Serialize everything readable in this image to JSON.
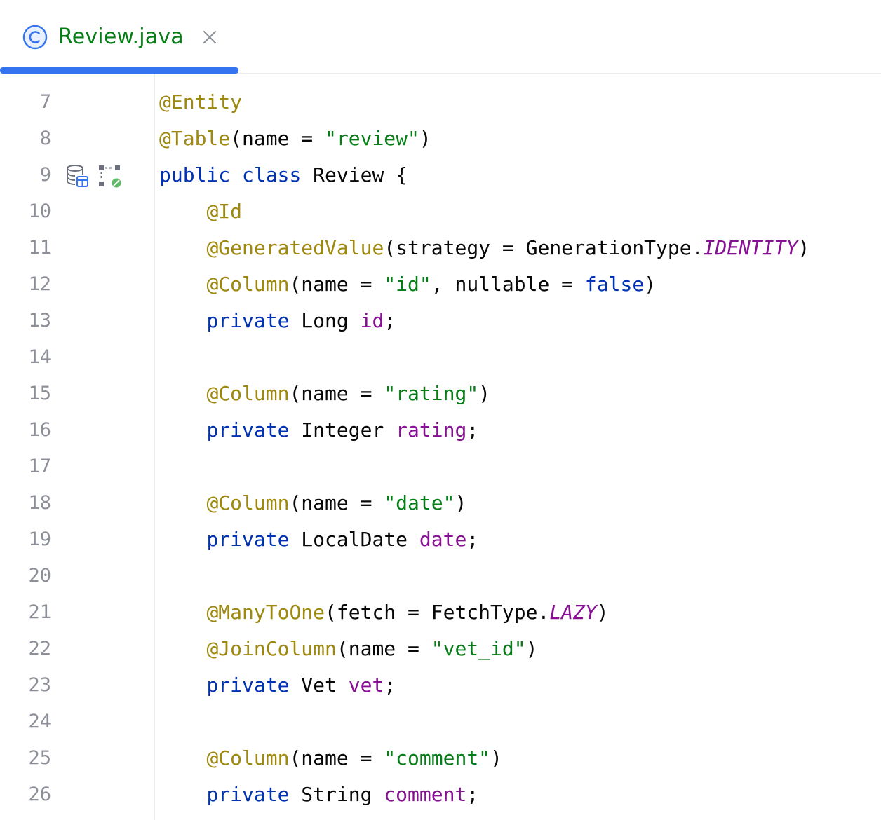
{
  "tab": {
    "title": "Review.java",
    "icon": "class-icon",
    "close_icon": "close-icon"
  },
  "editor": {
    "lines": [
      {
        "num": "7",
        "tokens": [
          [
            "ann",
            "@Entity"
          ]
        ]
      },
      {
        "num": "8",
        "tokens": [
          [
            "ann",
            "@Table"
          ],
          [
            "",
            "(name = "
          ],
          [
            "str",
            "\"review\""
          ],
          [
            "",
            ")"
          ]
        ]
      },
      {
        "num": "9",
        "tokens": [
          [
            "kw",
            "public"
          ],
          [
            "",
            " "
          ],
          [
            "kw",
            "class"
          ],
          [
            "",
            " Review {"
          ]
        ],
        "gutter_icons": [
          "database-table-icon",
          "entity-diagram-icon"
        ]
      },
      {
        "num": "10",
        "tokens": [
          [
            "",
            "    "
          ],
          [
            "ann",
            "@Id"
          ]
        ]
      },
      {
        "num": "11",
        "tokens": [
          [
            "",
            "    "
          ],
          [
            "ann",
            "@GeneratedValue"
          ],
          [
            "",
            "(strategy = GenerationType."
          ],
          [
            "ist",
            "IDENTITY"
          ],
          [
            "",
            ")"
          ]
        ]
      },
      {
        "num": "12",
        "tokens": [
          [
            "",
            "    "
          ],
          [
            "ann",
            "@Column"
          ],
          [
            "",
            "(name = "
          ],
          [
            "str",
            "\"id\""
          ],
          [
            "",
            ", nullable = "
          ],
          [
            "kw",
            "false"
          ],
          [
            "",
            ")"
          ]
        ]
      },
      {
        "num": "13",
        "tokens": [
          [
            "",
            "    "
          ],
          [
            "kw",
            "private"
          ],
          [
            "",
            " Long "
          ],
          [
            "fld",
            "id"
          ],
          [
            "",
            ";"
          ]
        ]
      },
      {
        "num": "14",
        "tokens": []
      },
      {
        "num": "15",
        "tokens": [
          [
            "",
            "    "
          ],
          [
            "ann",
            "@Column"
          ],
          [
            "",
            "(name = "
          ],
          [
            "str",
            "\"rating\""
          ],
          [
            "",
            ")"
          ]
        ]
      },
      {
        "num": "16",
        "tokens": [
          [
            "",
            "    "
          ],
          [
            "kw",
            "private"
          ],
          [
            "",
            " Integer "
          ],
          [
            "fld",
            "rating"
          ],
          [
            "",
            ";"
          ]
        ]
      },
      {
        "num": "17",
        "tokens": []
      },
      {
        "num": "18",
        "tokens": [
          [
            "",
            "    "
          ],
          [
            "ann",
            "@Column"
          ],
          [
            "",
            "(name = "
          ],
          [
            "str",
            "\"date\""
          ],
          [
            "",
            ")"
          ]
        ]
      },
      {
        "num": "19",
        "tokens": [
          [
            "",
            "    "
          ],
          [
            "kw",
            "private"
          ],
          [
            "",
            " LocalDate "
          ],
          [
            "fld",
            "date"
          ],
          [
            "",
            ";"
          ]
        ]
      },
      {
        "num": "20",
        "tokens": []
      },
      {
        "num": "21",
        "tokens": [
          [
            "",
            "    "
          ],
          [
            "ann",
            "@ManyToOne"
          ],
          [
            "",
            "(fetch = FetchType."
          ],
          [
            "ist",
            "LAZY"
          ],
          [
            "",
            ")"
          ]
        ]
      },
      {
        "num": "22",
        "tokens": [
          [
            "",
            "    "
          ],
          [
            "ann",
            "@JoinColumn"
          ],
          [
            "",
            "(name = "
          ],
          [
            "str",
            "\"vet_id\""
          ],
          [
            "",
            ")"
          ]
        ]
      },
      {
        "num": "23",
        "tokens": [
          [
            "",
            "    "
          ],
          [
            "kw",
            "private"
          ],
          [
            "",
            " Vet "
          ],
          [
            "fld",
            "vet"
          ],
          [
            "",
            ";"
          ]
        ]
      },
      {
        "num": "24",
        "tokens": []
      },
      {
        "num": "25",
        "tokens": [
          [
            "",
            "    "
          ],
          [
            "ann",
            "@Column"
          ],
          [
            "",
            "(name = "
          ],
          [
            "str",
            "\"comment\""
          ],
          [
            "",
            ")"
          ]
        ]
      },
      {
        "num": "26",
        "tokens": [
          [
            "",
            "    "
          ],
          [
            "kw",
            "private"
          ],
          [
            "",
            " String "
          ],
          [
            "fld",
            "comment"
          ],
          [
            "",
            ";"
          ]
        ]
      }
    ]
  },
  "colors": {
    "keyword": "#0033b3",
    "annotation": "#9e880d",
    "string": "#067d17",
    "field": "#871094",
    "accent": "#3574f0",
    "line_number": "#8c8f98"
  }
}
